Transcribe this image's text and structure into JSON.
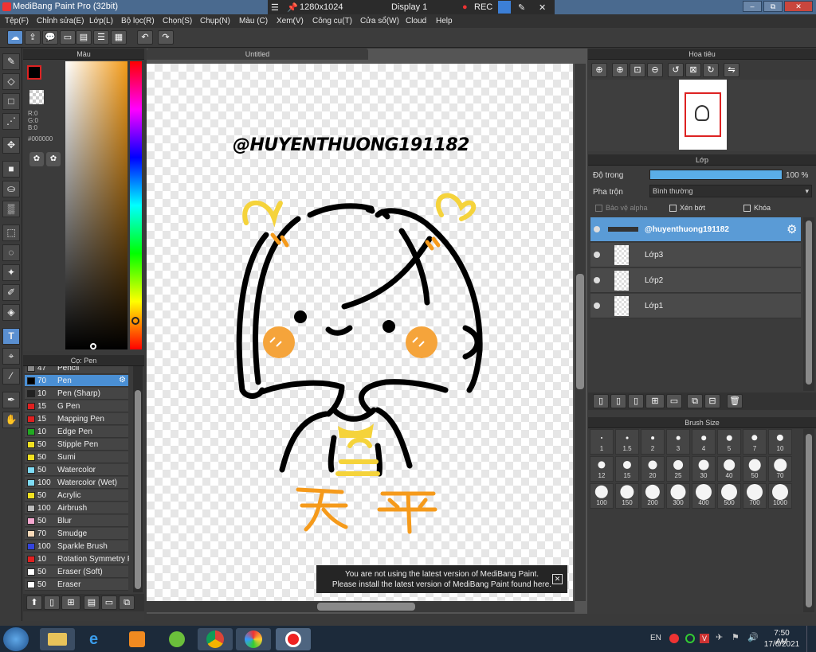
{
  "window": {
    "title": "MediBang Paint Pro (32bit)",
    "minimize": "–",
    "restore": "⧉",
    "close": "✕"
  },
  "recorder": {
    "resolution": "1280x1024",
    "display": "Display 1",
    "rec": "REC",
    "close": "✕"
  },
  "menu": [
    "Tệp(F)",
    "Chỉnh sửa(E)",
    "Lớp(L)",
    "Bộ lọc(R)",
    "Chọn(S)",
    "Chụp(N)",
    "Màu (C)",
    "Xem(V)",
    "Công cụ(T)",
    "Cửa sổ(W)",
    "Cloud",
    "Help"
  ],
  "color_panel": {
    "title": "Màu",
    "r": "R:0",
    "g": "G:0",
    "b": "B:0",
    "hex": "#000000"
  },
  "brush_panel": {
    "title": "Cọ: Pen",
    "items": [
      {
        "size": "47",
        "name": "Pencil",
        "color": "#888888"
      },
      {
        "size": "70",
        "name": "Pen",
        "color": "#000000",
        "selected": true
      },
      {
        "size": "10",
        "name": "Pen (Sharp)",
        "color": "#222222"
      },
      {
        "size": "15",
        "name": "G Pen",
        "color": "#e02020"
      },
      {
        "size": "15",
        "name": "Mapping Pen",
        "color": "#e02020"
      },
      {
        "size": "10",
        "name": "Edge Pen",
        "color": "#22aa22"
      },
      {
        "size": "50",
        "name": "Stipple Pen",
        "color": "#f2e020"
      },
      {
        "size": "50",
        "name": "Sumi",
        "color": "#f2e020"
      },
      {
        "size": "50",
        "name": "Watercolor",
        "color": "#7fdcf5"
      },
      {
        "size": "100",
        "name": "Watercolor (Wet)",
        "color": "#7fdcf5"
      },
      {
        "size": "50",
        "name": "Acrylic",
        "color": "#f2e020"
      },
      {
        "size": "100",
        "name": "Airbrush",
        "color": "#bbbbbb"
      },
      {
        "size": "50",
        "name": "Blur",
        "color": "#f5a8d0"
      },
      {
        "size": "70",
        "name": "Smudge",
        "color": "#f7d9b8"
      },
      {
        "size": "100",
        "name": "Sparkle Brush",
        "color": "#3344dd"
      },
      {
        "size": "10",
        "name": "Rotation Symmetry P",
        "color": "#e02020"
      },
      {
        "size": "50",
        "name": "Eraser (Soft)",
        "color": "#ffffff"
      },
      {
        "size": "50",
        "name": "Eraser",
        "color": "#ffffff"
      }
    ]
  },
  "canvas": {
    "tab": "Untitled",
    "signature": "@HUYENTHUONG191182"
  },
  "notice": {
    "line1": "You are not using the latest version of MediBang Paint.",
    "line2": "Please install the latest version of MediBang Paint found here.",
    "close": "✕"
  },
  "navigator": {
    "title": "Hoa tiêu"
  },
  "layers": {
    "title": "Lớp",
    "opacity_label": "Độ trong",
    "opacity_value": "100 %",
    "opacity": 1.0,
    "blend_label": "Pha trộn",
    "blend_value": "Bình thường",
    "protect_alpha": "Bảo vệ alpha",
    "clipping": "Xén bớt",
    "lock": "Khóa",
    "items": [
      {
        "name": "@huyenthuong191182",
        "selected": true
      },
      {
        "name": "Lớp3"
      },
      {
        "name": "Lớp2"
      },
      {
        "name": "Lớp1"
      }
    ]
  },
  "brush_size": {
    "title": "Brush Size",
    "sizes": [
      "1",
      "1.5",
      "2",
      "3",
      "4",
      "5",
      "7",
      "10",
      "12",
      "15",
      "20",
      "25",
      "30",
      "40",
      "50",
      "70",
      "100",
      "150",
      "200",
      "300",
      "400",
      "500",
      "700",
      "1000"
    ]
  },
  "taskbar": {
    "lang": "EN",
    "time": "7:50 AM",
    "date": "17/6/2021"
  }
}
